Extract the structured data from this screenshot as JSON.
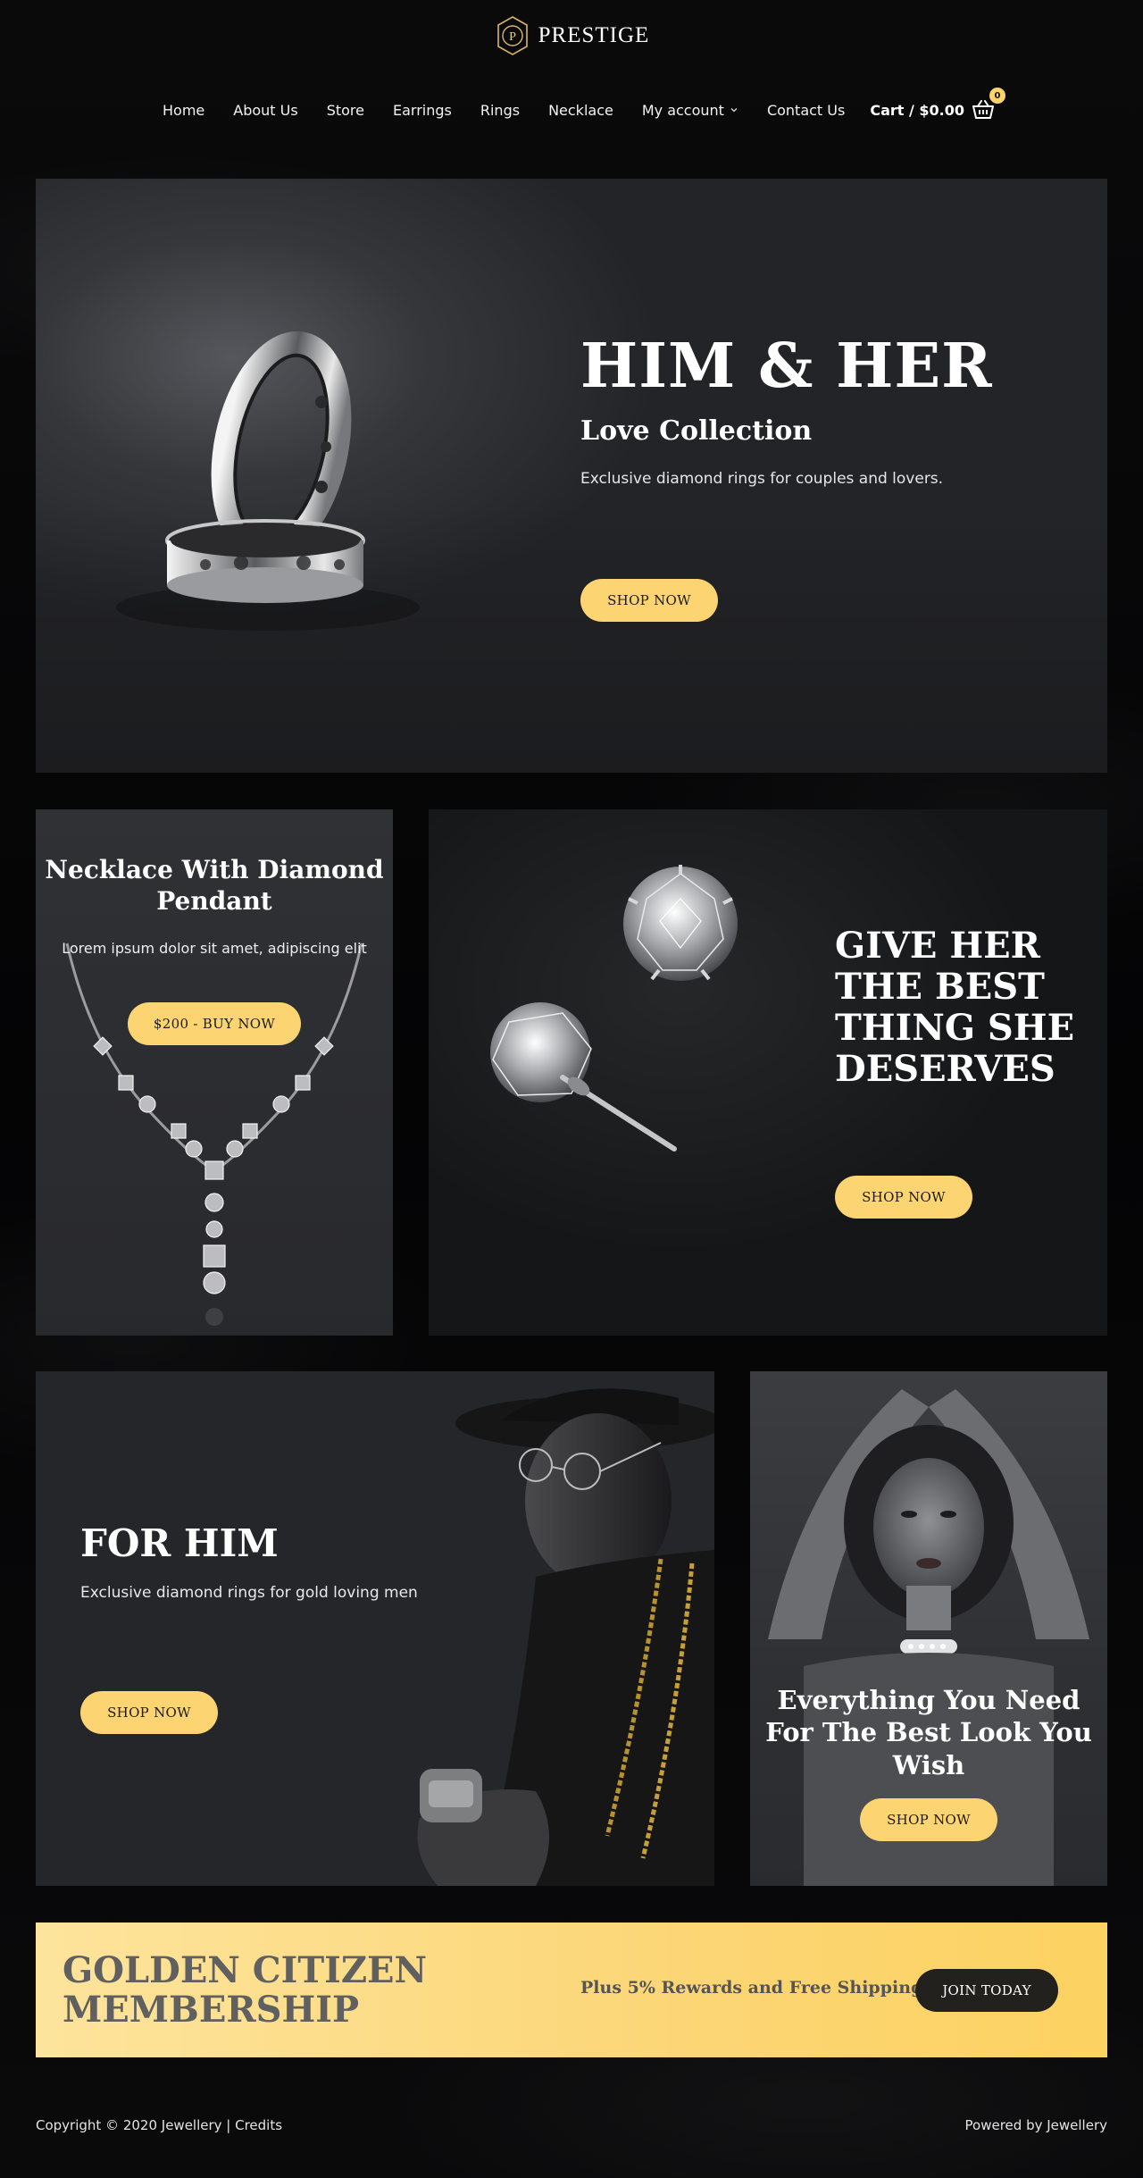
{
  "header": {
    "brand": "PRESTIGE",
    "logo_letter": "P",
    "nav": [
      {
        "label": "Home"
      },
      {
        "label": "About Us"
      },
      {
        "label": "Store"
      },
      {
        "label": "Earrings"
      },
      {
        "label": "Rings"
      },
      {
        "label": "Necklace"
      },
      {
        "label": "My account",
        "has_dropdown": true
      },
      {
        "label": "Contact Us"
      }
    ],
    "cart": {
      "label": "Cart / $0.00",
      "count": "0",
      "icon": "basket-icon"
    }
  },
  "hero": {
    "title": "HIM & HER",
    "subtitle": "Love Collection",
    "text": "Exclusive diamond rings for couples and lovers.",
    "button": "SHOP NOW"
  },
  "necklace": {
    "title": "Necklace With Diamond Pendant",
    "text": "Lorem ipsum dolor sit amet, adipiscing elit",
    "button": "$200 - BUY NOW"
  },
  "earrings": {
    "title": "GIVE HER THE BEST THING SHE DESERVES",
    "button": "SHOP NOW"
  },
  "for_him": {
    "title": "FOR HIM",
    "text": "Exclusive diamond rings for gold loving men",
    "button": "SHOP NOW"
  },
  "for_her": {
    "title": "Everything You Need For The Best Look You Wish",
    "button": "SHOP NOW"
  },
  "membership": {
    "title": "GOLDEN CITIZEN MEMBERSHIP",
    "perk": "Plus 5% Rewards and Free Shipping",
    "button": "JOIN TODAY"
  },
  "footer": {
    "copyright": "Copyright © 2020 Jewellery | Credits",
    "powered": "Powered by Jewellery"
  },
  "colors": {
    "accent": "#fcd471",
    "background": "#050506",
    "panel": "#252629",
    "dark_button": "#23211d"
  }
}
